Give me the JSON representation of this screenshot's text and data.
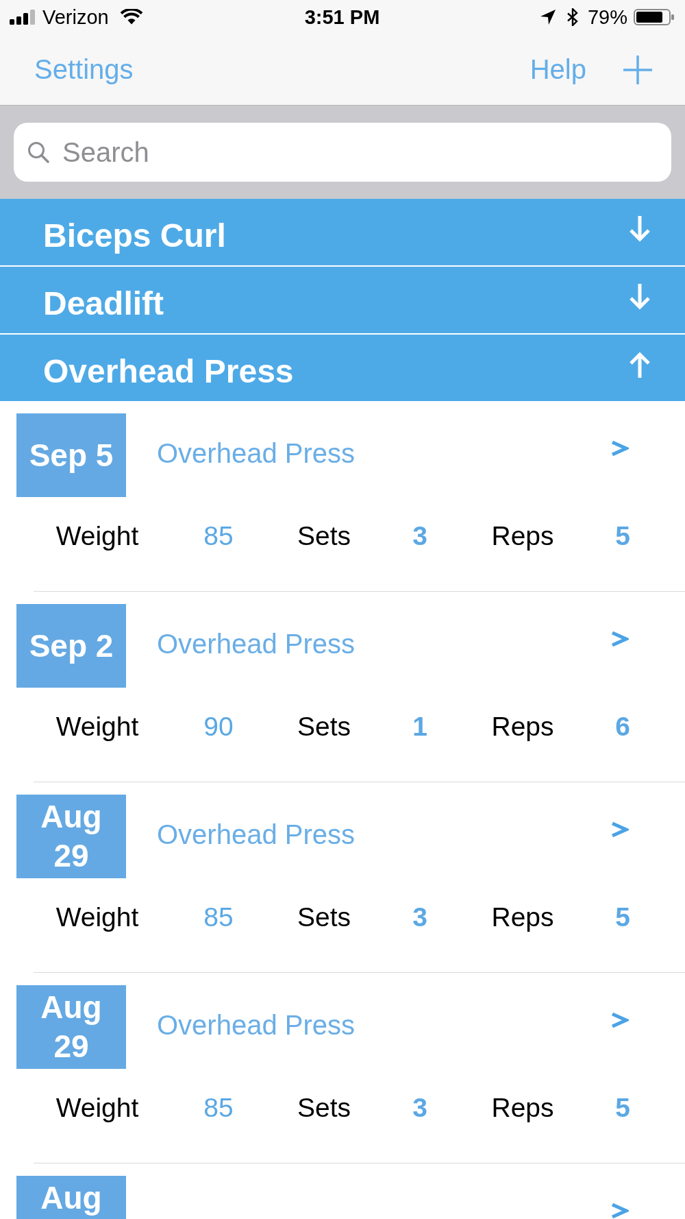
{
  "status_bar": {
    "carrier": "Verizon",
    "time": "3:51 PM",
    "battery": "79%"
  },
  "nav": {
    "left": "Settings",
    "right": "Help"
  },
  "search": {
    "placeholder": "Search"
  },
  "sections": [
    {
      "title": "Biceps Curl",
      "expanded": false
    },
    {
      "title": "Deadlift",
      "expanded": false
    },
    {
      "title": "Overhead Press",
      "expanded": true,
      "entries": [
        {
          "date": "Sep 5",
          "title": "Overhead Press",
          "fields": [
            {
              "label": "Weight",
              "value": "85"
            },
            {
              "label": "Sets",
              "value": "3"
            },
            {
              "label": "Reps",
              "value": "5"
            }
          ]
        },
        {
          "date": "Sep 2",
          "title": "Overhead Press",
          "fields": [
            {
              "label": "Weight",
              "value": "90"
            },
            {
              "label": "Sets",
              "value": "1"
            },
            {
              "label": "Reps",
              "value": "6"
            }
          ]
        },
        {
          "date": "Aug 29",
          "title": "Overhead Press",
          "fields": [
            {
              "label": "Weight",
              "value": "85"
            },
            {
              "label": "Sets",
              "value": "3"
            },
            {
              "label": "Reps",
              "value": "5"
            }
          ]
        },
        {
          "date": "Aug 29",
          "title": "Overhead Press",
          "fields": [
            {
              "label": "Weight",
              "value": "85"
            },
            {
              "label": "Sets",
              "value": "3"
            },
            {
              "label": "Reps",
              "value": "5"
            }
          ]
        },
        {
          "date": "Aug"
        }
      ]
    }
  ]
}
